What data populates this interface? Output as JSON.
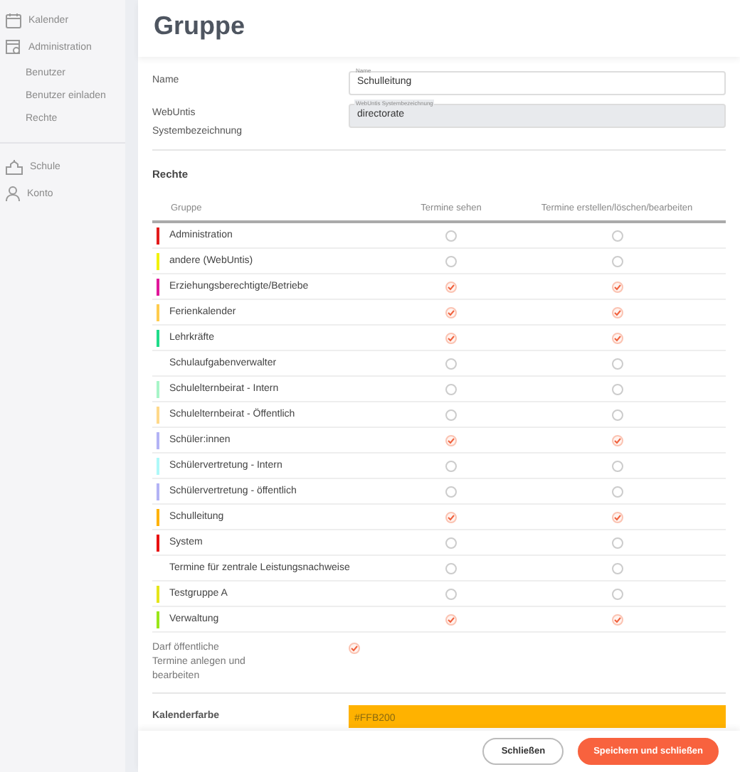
{
  "sidebar": {
    "items": [
      {
        "label": "Kalender"
      },
      {
        "label": "Administration",
        "children": [
          {
            "label": "Benutzer"
          },
          {
            "label": "Benutzer einladen"
          },
          {
            "label": "Rechte"
          }
        ]
      },
      {
        "label": "Schule"
      },
      {
        "label": "Konto"
      }
    ]
  },
  "page_title": "Gruppe",
  "form": {
    "fields": [
      {
        "label": "Name",
        "float_label": "Name",
        "value": "Schulleitung",
        "disabled": false
      },
      {
        "label": "WebUntis Systembezeichnung",
        "float_label": "WebUntis Systembezeichnung",
        "value": "directorate",
        "disabled": true
      }
    ]
  },
  "rights": {
    "title": "Rechte",
    "columns": [
      "Gruppe",
      "Termine sehen",
      "Termine erstellen/löschen/bearbeiten"
    ],
    "rows": [
      {
        "name": "Administration",
        "color": "#e21b1b",
        "see": false,
        "edit": false
      },
      {
        "name": "andere (WebUntis)",
        "color": "#f2f20c",
        "see": false,
        "edit": false
      },
      {
        "name": "Erziehungsberechtigte/Betriebe",
        "color": "#e0179a",
        "see": true,
        "edit": true
      },
      {
        "name": "Ferienkalender",
        "color": "#ffcc4d",
        "see": true,
        "edit": true
      },
      {
        "name": "Lehrkräfte",
        "color": "#1fdc8a",
        "see": true,
        "edit": true
      },
      {
        "name": "Schulaufgabenverwalter",
        "see": false,
        "edit": false
      },
      {
        "name": "Schulelternbeirat - Intern",
        "color": "#a8f5c8",
        "see": false,
        "edit": false
      },
      {
        "name": "Schulelternbeirat - Öffentlich",
        "color": "#ffd98a",
        "see": false,
        "edit": false
      },
      {
        "name": "Schüler:innen",
        "color": "#b3b3f5",
        "see": true,
        "edit": true
      },
      {
        "name": "Schülervertretung - Intern",
        "color": "#aef8f8",
        "see": false,
        "edit": false
      },
      {
        "name": "Schülervertretung - öffentlich",
        "color": "#b3b3f5",
        "see": false,
        "edit": false
      },
      {
        "name": "Schulleitung",
        "color": "#ffb200",
        "see": true,
        "edit": true
      },
      {
        "name": "System",
        "color": "#e81010",
        "see": false,
        "edit": false
      },
      {
        "name": "Termine für zentrale Leistungsnachweise",
        "see": false,
        "edit": false
      },
      {
        "name": "Testgruppe A",
        "color": "#e5e51a",
        "see": false,
        "edit": false
      },
      {
        "name": "Verwaltung",
        "color": "#99e619",
        "see": true,
        "edit": true
      }
    ]
  },
  "public_events": {
    "label": "Darf öffentliche Termine anlegen und bearbeiten",
    "checked": true
  },
  "calendar_color": {
    "label": "Kalenderfarbe",
    "value": "#FFB200",
    "color": "#ffb200"
  },
  "buttons": [
    {
      "label": "Schließen",
      "kind": "secondary"
    },
    {
      "label": "Speichern und schließen",
      "kind": "primary"
    }
  ]
}
